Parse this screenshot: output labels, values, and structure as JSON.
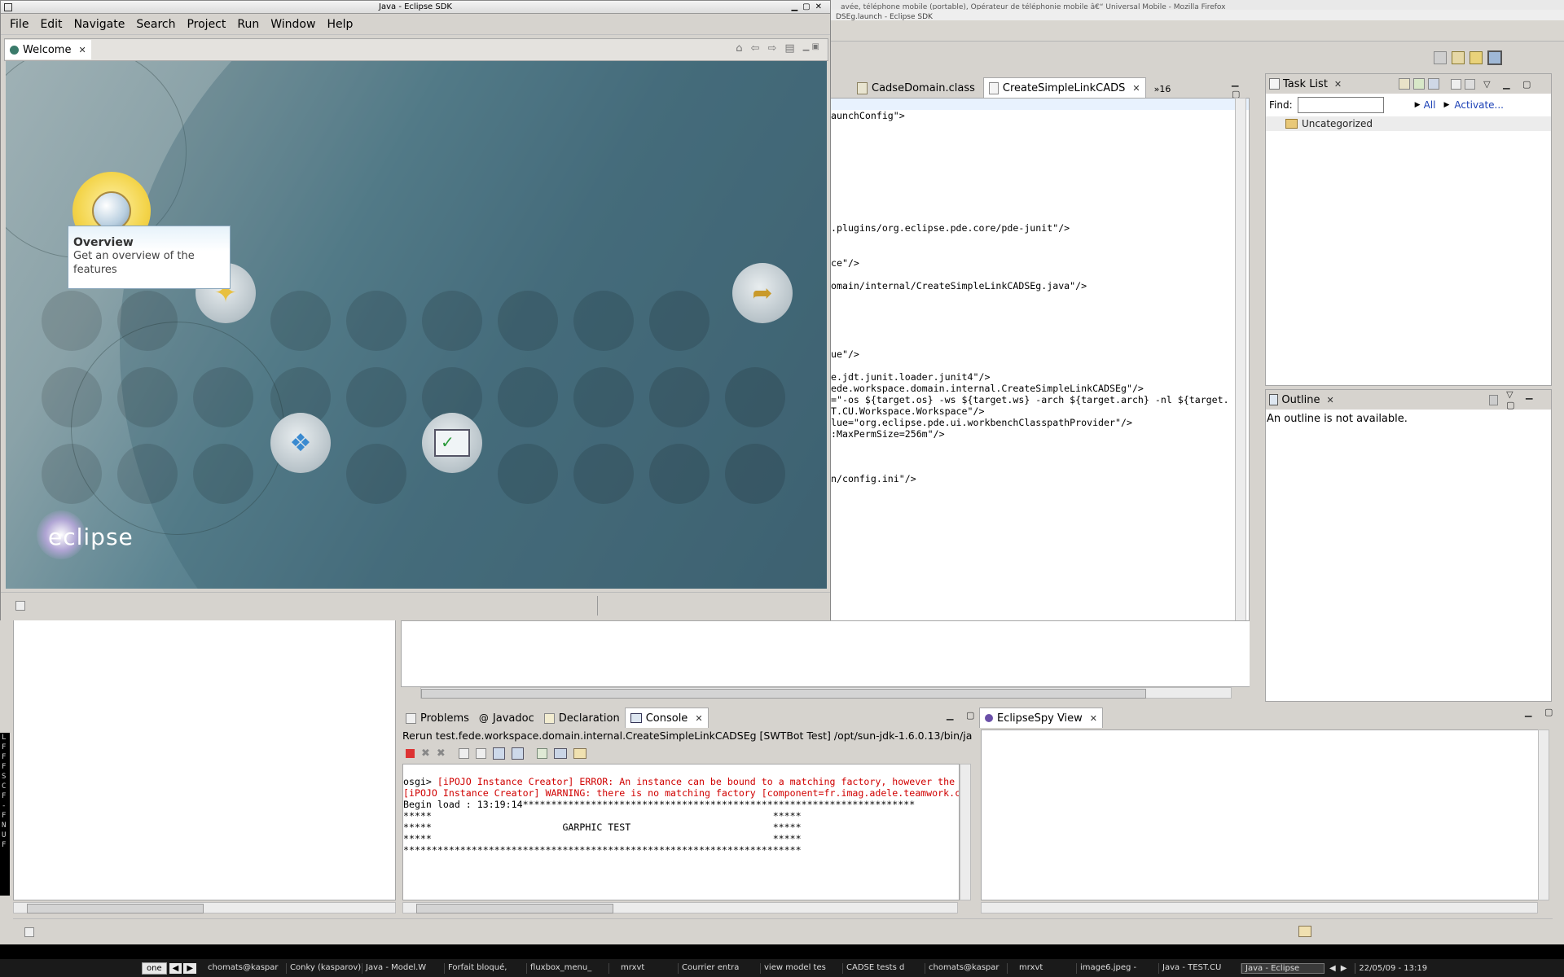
{
  "firefox_bar": {
    "title": "avée, téléphone mobile (portable), Opérateur de téléphonie mobile â€“ Universal Mobile - Mozilla Firefox"
  },
  "bg_eclipse": {
    "title": "DSEg.launch - Eclipse SDK",
    "editor_tabs": [
      {
        "label": "CadseDomain.class"
      },
      {
        "label": "CreateSimpleLinkCADS"
      }
    ],
    "more_tabs": "»16",
    "editor_lines": [
      "aunchConfig\">",
      ".plugins/org.eclipse.pde.core/pde-junit\"/>",
      "ce\"/>",
      "omain/internal/CreateSimpleLinkCADSEg.java\"/>",
      "ue\"/>",
      "e.jdt.junit.loader.junit4\"/>",
      "ede.workspace.domain.internal.CreateSimpleLinkCADSEg\"/>",
      "=\"-os ${target.os} -ws ${target.ws} -arch ${target.arch} -nl ${target.",
      "T.CU.Workspace.Workspace\"/>",
      "lue=\"org.eclipse.pde.ui.workbenchClasspathProvider\"/>",
      ":MaxPermSize=256m\"/>",
      "n/config.ini\"/>"
    ],
    "task_list": {
      "title": "Task List",
      "find_label": "Find:",
      "find_value": "",
      "all_link": "All",
      "activate_link": "Activate...",
      "items": [
        "Uncategorized"
      ]
    },
    "outline": {
      "title": "Outline",
      "message": "An outline is not available."
    },
    "bottom_tabs": [
      {
        "label": "Problems"
      },
      {
        "label": "Javadoc"
      },
      {
        "label": "Declaration"
      },
      {
        "label": "Console"
      }
    ],
    "console": {
      "header": "Rerun test.fede.workspace.domain.internal.CreateSimpleLinkCADSEg [SWTBot Test] /opt/sun-jdk-1.6.0.13/bin/jav",
      "lines": [
        {
          "text": "osgi> ",
          "red": "[iPOJO Instance Creator] ERROR: An instance can be bound to a matching factory, however the"
        },
        {
          "text": "",
          "red": "[iPOJO Instance Creator] WARNING: there is no matching factory [component=fr.imag.adele.teamwork.c"
        },
        {
          "text": "Begin load : 13:19:14*********************************************************************",
          "red": ""
        },
        {
          "text": "*****                                                            *****",
          "red": ""
        },
        {
          "text": "*****                       GARPHIC TEST                         *****",
          "red": ""
        },
        {
          "text": "*****                                                            *****",
          "red": ""
        },
        {
          "text": "**********************************************************************",
          "red": ""
        }
      ]
    },
    "spy": {
      "title": "EclipseSpy View"
    }
  },
  "welcome_window": {
    "title": "Java - Eclipse SDK",
    "menu": [
      "File",
      "Edit",
      "Navigate",
      "Search",
      "Project",
      "Run",
      "Window",
      "Help"
    ],
    "tab_label": "Welcome",
    "tooltip": {
      "title": "Overview",
      "desc": "Get an overview of the features"
    },
    "logo_text": "eclipse"
  },
  "taskbar": {
    "workspace": "one",
    "items": [
      "chomats@kaspar",
      "Conky (kasparov)",
      "Java - Model.W",
      "Forfait bloqué,",
      "fluxbox_menu_",
      "mrxvt",
      "Courrier entra",
      "view model tes",
      "CADSE tests d",
      "chomats@kaspar",
      "mrxvt",
      "image6.jpeg -",
      "Java - TEST.CU",
      "Java - Eclipse"
    ],
    "clock": "22/05/09 - 13:19"
  },
  "left_sidebar_letters": [
    "L",
    "F",
    "F",
    "F",
    "S",
    "C",
    "F",
    "-",
    "F",
    "N",
    "U",
    "F"
  ]
}
